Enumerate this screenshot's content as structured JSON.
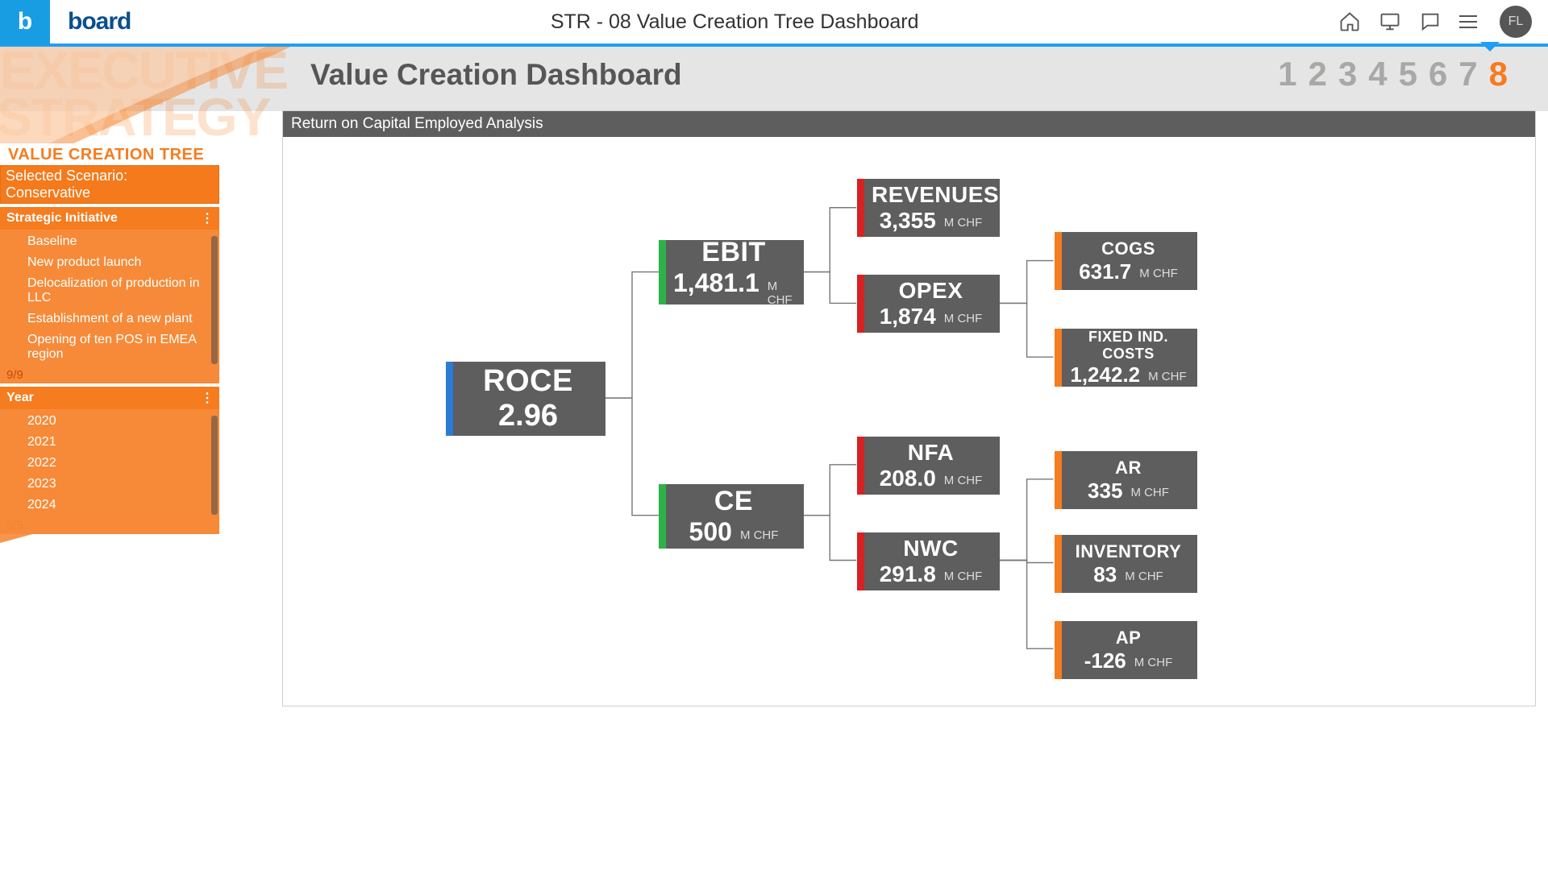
{
  "app": {
    "title": "STR - 08 Value Creation Tree Dashboard",
    "avatar_initials": "FL",
    "logo_text": "board"
  },
  "strip": {
    "title": "Value Creation Dashboard",
    "exec_line1": "EXECUTIVE",
    "exec_line2": "STRATEGY",
    "vct_label": "VALUE CREATION TREE",
    "pages": [
      "1",
      "2",
      "3",
      "4",
      "5",
      "6",
      "7",
      "8"
    ],
    "active_page_index": 7
  },
  "sidebar": {
    "scenario_label": "Selected Scenario: Conservative",
    "initiative": {
      "header": "Strategic Initiative",
      "items": [
        "Baseline",
        "New product launch",
        "Delocalization of production in LLC",
        "Establishment of a new plant",
        "Opening of ten POS in EMEA region"
      ],
      "footer": "9/9"
    },
    "year": {
      "header": "Year",
      "items": [
        "2020",
        "2021",
        "2022",
        "2023",
        "2024"
      ],
      "footer": "5/5"
    }
  },
  "panel": {
    "title": "Return on Capital Employed Analysis"
  },
  "unit": "M CHF",
  "nodes": {
    "roce": {
      "label": "ROCE",
      "value": "2.96",
      "unit": "",
      "bar": "blue"
    },
    "ebit": {
      "label": "EBIT",
      "value": "1,481.1",
      "unit": "M CHF",
      "bar": "green"
    },
    "ce": {
      "label": "CE",
      "value": "500",
      "unit": "M CHF",
      "bar": "green"
    },
    "rev": {
      "label": "REVENUES",
      "value": "3,355",
      "unit": "M CHF",
      "bar": "red"
    },
    "opex": {
      "label": "OPEX",
      "value": "1,874",
      "unit": "M CHF",
      "bar": "red"
    },
    "nfa": {
      "label": "NFA",
      "value": "208.0",
      "unit": "M CHF",
      "bar": "red"
    },
    "nwc": {
      "label": "NWC",
      "value": "291.8",
      "unit": "M CHF",
      "bar": "red"
    },
    "cogs": {
      "label": "COGS",
      "value": "631.7",
      "unit": "M CHF",
      "bar": "orange"
    },
    "fic": {
      "label": "FIXED IND. COSTS",
      "value": "1,242.2",
      "unit": "M CHF",
      "bar": "orange"
    },
    "ar": {
      "label": "AR",
      "value": "335",
      "unit": "M CHF",
      "bar": "orange"
    },
    "inv": {
      "label": "INVENTORY",
      "value": "83",
      "unit": "M CHF",
      "bar": "orange"
    },
    "ap": {
      "label": "AP",
      "value": "-126",
      "unit": "M CHF",
      "bar": "orange"
    }
  },
  "node_bar_colors": {
    "blue": "bar-blue",
    "green": "bar-green",
    "red": "bar-red",
    "orange": "bar-orange"
  },
  "chart_data": {
    "type": "tree",
    "title": "Return on Capital Employed Analysis",
    "unit": "M CHF",
    "root": {
      "name": "ROCE",
      "value": 2.96,
      "unit": "",
      "children": [
        {
          "name": "EBIT",
          "value": 1481.1,
          "children": [
            {
              "name": "REVENUES",
              "value": 3355
            },
            {
              "name": "OPEX",
              "value": 1874,
              "children": [
                {
                  "name": "COGS",
                  "value": 631.7
                },
                {
                  "name": "FIXED IND. COSTS",
                  "value": 1242.2
                }
              ]
            }
          ]
        },
        {
          "name": "CE",
          "value": 500,
          "children": [
            {
              "name": "NFA",
              "value": 208.0
            },
            {
              "name": "NWC",
              "value": 291.8,
              "children": [
                {
                  "name": "AR",
                  "value": 335
                },
                {
                  "name": "INVENTORY",
                  "value": 83
                },
                {
                  "name": "AP",
                  "value": -126
                }
              ]
            }
          ]
        }
      ]
    }
  }
}
